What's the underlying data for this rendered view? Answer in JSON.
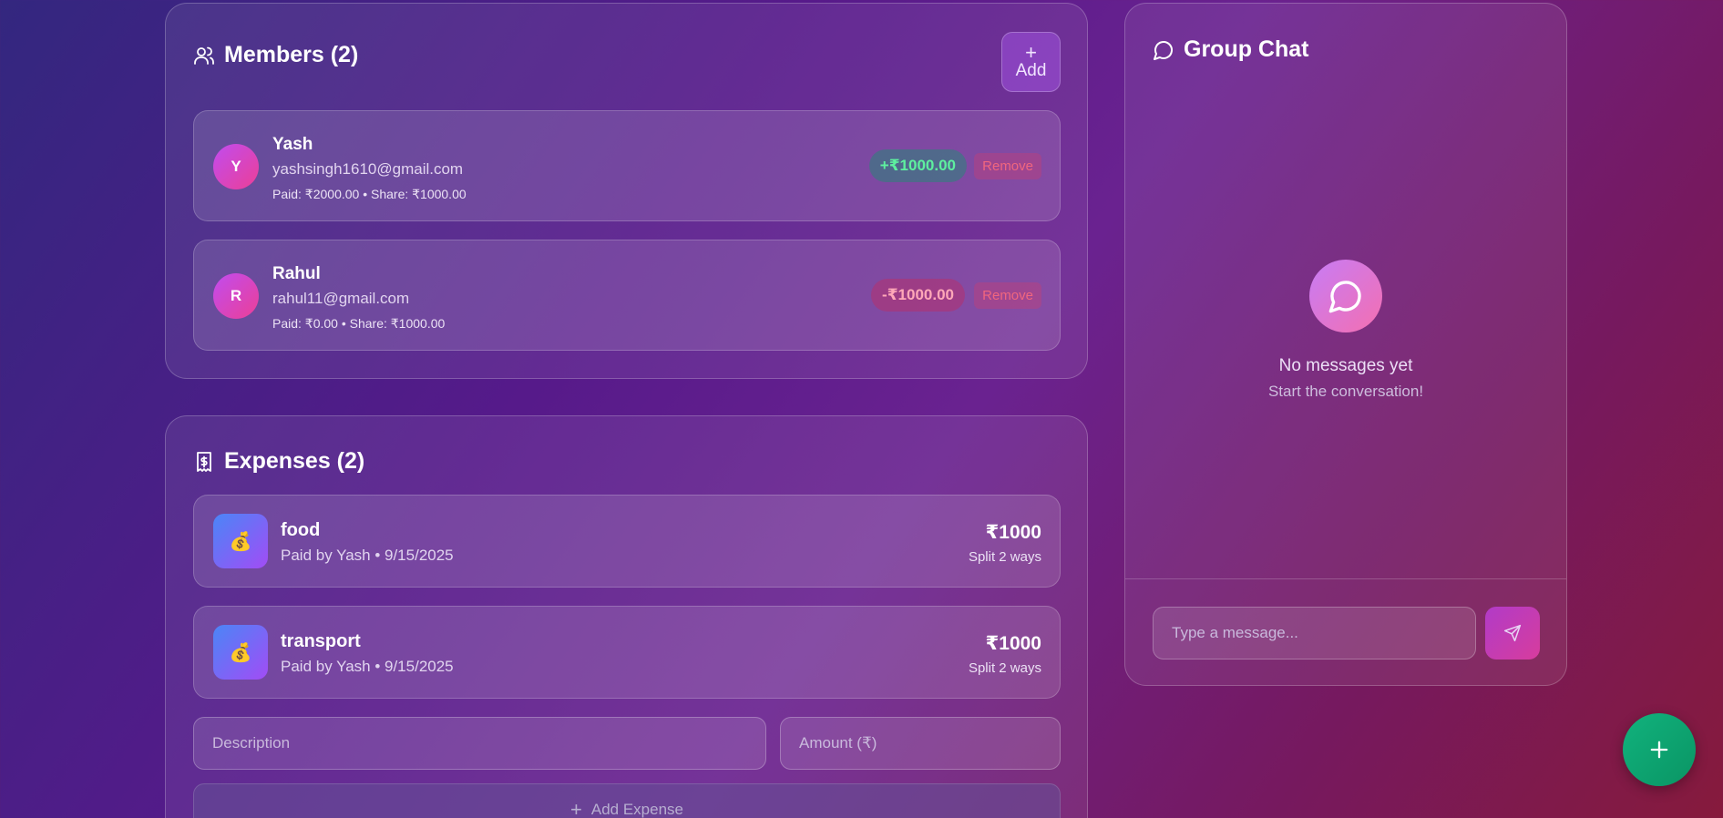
{
  "members": {
    "title": "Members (2)",
    "add_label": "Add",
    "items": [
      {
        "initial": "Y",
        "name": "Yash",
        "email": "yashsingh1610@gmail.com",
        "stats": "Paid: ₹2000.00 • Share: ₹1000.00",
        "balance": "+₹1000.00",
        "remove_label": "Remove"
      },
      {
        "initial": "R",
        "name": "Rahul",
        "email": "rahul11@gmail.com",
        "stats": "Paid: ₹0.00 • Share: ₹1000.00",
        "balance": "-₹1000.00",
        "remove_label": "Remove"
      }
    ]
  },
  "expenses": {
    "title": "Expenses (2)",
    "items": [
      {
        "icon": "💰",
        "name": "food",
        "meta": "Paid by Yash • 9/15/2025",
        "amount": "₹1000",
        "split": "Split 2 ways"
      },
      {
        "icon": "💰",
        "name": "transport",
        "meta": "Paid by Yash • 9/15/2025",
        "amount": "₹1000",
        "split": "Split 2 ways"
      }
    ],
    "description_placeholder": "Description",
    "amount_placeholder": "Amount (₹)",
    "add_label": "Add Expense"
  },
  "chat": {
    "title": "Group Chat",
    "empty_title": "No messages yet",
    "empty_subtitle": "Start the conversation!",
    "message_placeholder": "Type a message..."
  },
  "icons": {
    "members": "users-icon",
    "expenses": "receipt-icon",
    "chat": "message-circle-icon",
    "send": "send-icon",
    "fab": "plus-icon"
  },
  "colors": {
    "positive": "#5ef09f",
    "negative": "#ffa8b8",
    "fab": "#11b27d",
    "remove": "#f0667e"
  }
}
